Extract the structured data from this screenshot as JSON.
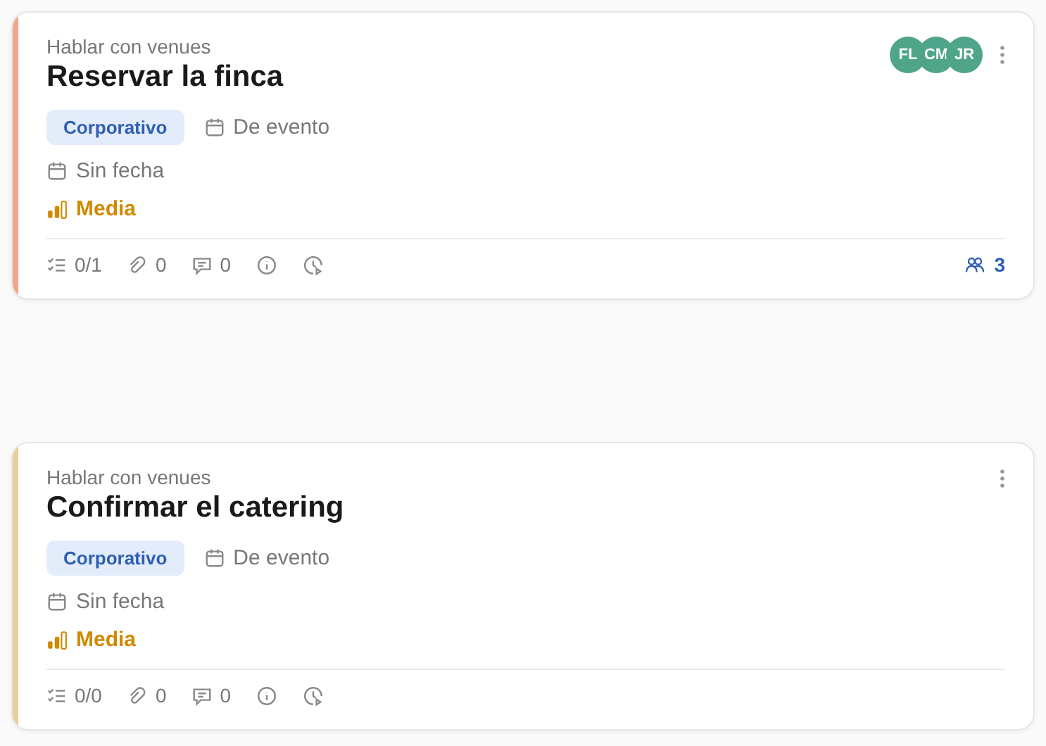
{
  "cards": [
    {
      "color": "#f4a58a",
      "subtitle": "Hablar con venues",
      "title": "Reservar la finca",
      "tag": "Corporativo",
      "event_type": "De evento",
      "date": "Sin fecha",
      "priority": "Media",
      "avatars": [
        "FL",
        "CM",
        "JR"
      ],
      "stats": [
        {
          "kind": "checklist",
          "text": "0/1"
        },
        {
          "kind": "attachments",
          "text": "0"
        },
        {
          "kind": "comments",
          "text": "0"
        },
        {
          "kind": "info"
        },
        {
          "kind": "time"
        }
      ],
      "members": "3"
    },
    {
      "color": "#e9cf95",
      "subtitle": "Hablar con venues",
      "title": "Confirmar el catering",
      "tag": "Corporativo",
      "event_type": "De evento",
      "date": "Sin fecha",
      "priority": "Media",
      "stats": [
        {
          "kind": "checklist",
          "text": "0/0"
        },
        {
          "kind": "attachments",
          "text": "0"
        },
        {
          "kind": "comments",
          "text": "0"
        },
        {
          "kind": "info"
        },
        {
          "kind": "time"
        }
      ]
    }
  ]
}
